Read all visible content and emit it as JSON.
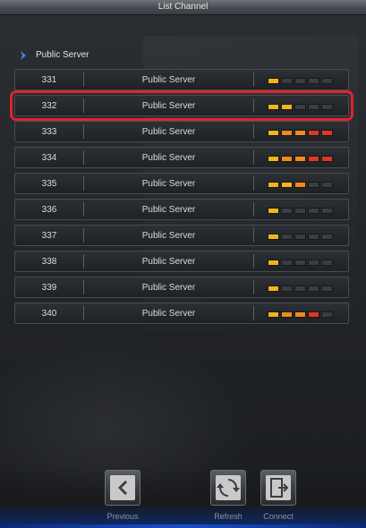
{
  "window": {
    "title": "List Channel"
  },
  "section": {
    "label": "Public Server"
  },
  "load_colors": {
    "empty": "#3a3d41",
    "low": "#f3b51a",
    "mid": "#f08a1e",
    "high": "#e2371f"
  },
  "channels": [
    {
      "number": "331",
      "name": "Public Server",
      "load": [
        "low",
        "empty",
        "empty",
        "empty",
        "empty"
      ]
    },
    {
      "number": "332",
      "name": "Public Server",
      "load": [
        "low",
        "low",
        "empty",
        "empty",
        "empty"
      ],
      "selected": true
    },
    {
      "number": "333",
      "name": "Public Server",
      "load": [
        "low",
        "mid",
        "mid",
        "high",
        "high"
      ]
    },
    {
      "number": "334",
      "name": "Public Server",
      "load": [
        "low",
        "mid",
        "mid",
        "high",
        "high"
      ]
    },
    {
      "number": "335",
      "name": "Public Server",
      "load": [
        "low",
        "low",
        "mid",
        "empty",
        "empty"
      ]
    },
    {
      "number": "336",
      "name": "Public Server",
      "load": [
        "low",
        "empty",
        "empty",
        "empty",
        "empty"
      ]
    },
    {
      "number": "337",
      "name": "Public Server",
      "load": [
        "low",
        "empty",
        "empty",
        "empty",
        "empty"
      ]
    },
    {
      "number": "338",
      "name": "Public Server",
      "load": [
        "low",
        "empty",
        "empty",
        "empty",
        "empty"
      ]
    },
    {
      "number": "339",
      "name": "Public Server",
      "load": [
        "low",
        "empty",
        "empty",
        "empty",
        "empty"
      ]
    },
    {
      "number": "340",
      "name": "Public Server",
      "load": [
        "low",
        "mid",
        "mid",
        "high",
        "empty"
      ]
    }
  ],
  "buttons": {
    "previous": {
      "label": "Previous",
      "icon": "arrow-left-icon"
    },
    "refresh": {
      "label": "Refresh",
      "icon": "refresh-icon"
    },
    "connect": {
      "label": "Connect",
      "icon": "door-exit-icon"
    }
  }
}
